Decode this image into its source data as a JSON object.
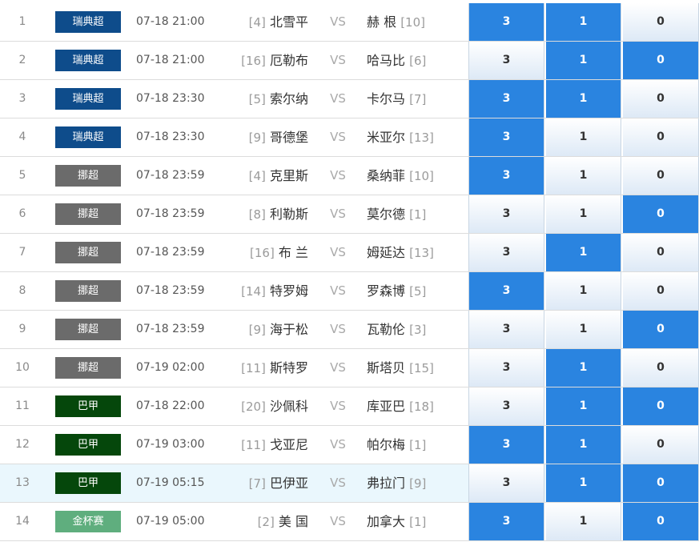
{
  "colors": {
    "selected_cell": "#2a84e0",
    "highlight_row": "#eaf7fd"
  },
  "leagues": {
    "瑞典超": "#0e4c8b",
    "挪超": "#6b6b6b",
    "巴甲": "#05470b",
    "金杯赛": "#5fae7e"
  },
  "vs_label": "VS",
  "matches": [
    {
      "num": "1",
      "league": "瑞典超",
      "time": "07-18 21:00",
      "home_rank": "[4]",
      "home": "北雪平",
      "away": "赫 根",
      "away_rank": "[10]",
      "win": "3",
      "draw": "1",
      "lose": "0",
      "selected": [
        true,
        true,
        false
      ],
      "highlight": false
    },
    {
      "num": "2",
      "league": "瑞典超",
      "time": "07-18 21:00",
      "home_rank": "[16]",
      "home": "厄勒布",
      "away": "哈马比",
      "away_rank": "[6]",
      "win": "3",
      "draw": "1",
      "lose": "0",
      "selected": [
        false,
        true,
        true
      ],
      "highlight": false
    },
    {
      "num": "3",
      "league": "瑞典超",
      "time": "07-18 23:30",
      "home_rank": "[5]",
      "home": "索尔纳",
      "away": "卡尔马",
      "away_rank": "[7]",
      "win": "3",
      "draw": "1",
      "lose": "0",
      "selected": [
        true,
        true,
        false
      ],
      "highlight": false
    },
    {
      "num": "4",
      "league": "瑞典超",
      "time": "07-18 23:30",
      "home_rank": "[9]",
      "home": "哥德堡",
      "away": "米亚尔",
      "away_rank": "[13]",
      "win": "3",
      "draw": "1",
      "lose": "0",
      "selected": [
        true,
        false,
        false
      ],
      "highlight": false
    },
    {
      "num": "5",
      "league": "挪超",
      "time": "07-18 23:59",
      "home_rank": "[4]",
      "home": "克里斯",
      "away": "桑纳菲",
      "away_rank": "[10]",
      "win": "3",
      "draw": "1",
      "lose": "0",
      "selected": [
        true,
        false,
        false
      ],
      "highlight": false
    },
    {
      "num": "6",
      "league": "挪超",
      "time": "07-18 23:59",
      "home_rank": "[8]",
      "home": "利勒斯",
      "away": "莫尔德",
      "away_rank": "[1]",
      "win": "3",
      "draw": "1",
      "lose": "0",
      "selected": [
        false,
        false,
        true
      ],
      "highlight": false
    },
    {
      "num": "7",
      "league": "挪超",
      "time": "07-18 23:59",
      "home_rank": "[16]",
      "home": "布 兰",
      "away": "姆延达",
      "away_rank": "[13]",
      "win": "3",
      "draw": "1",
      "lose": "0",
      "selected": [
        false,
        true,
        false
      ],
      "highlight": false
    },
    {
      "num": "8",
      "league": "挪超",
      "time": "07-18 23:59",
      "home_rank": "[14]",
      "home": "特罗姆",
      "away": "罗森博",
      "away_rank": "[5]",
      "win": "3",
      "draw": "1",
      "lose": "0",
      "selected": [
        true,
        false,
        false
      ],
      "highlight": false
    },
    {
      "num": "9",
      "league": "挪超",
      "time": "07-18 23:59",
      "home_rank": "[9]",
      "home": "海于松",
      "away": "瓦勒伦",
      "away_rank": "[3]",
      "win": "3",
      "draw": "1",
      "lose": "0",
      "selected": [
        false,
        false,
        true
      ],
      "highlight": false
    },
    {
      "num": "10",
      "league": "挪超",
      "time": "07-19 02:00",
      "home_rank": "[11]",
      "home": "斯特罗",
      "away": "斯塔贝",
      "away_rank": "[15]",
      "win": "3",
      "draw": "1",
      "lose": "0",
      "selected": [
        false,
        true,
        false
      ],
      "highlight": false
    },
    {
      "num": "11",
      "league": "巴甲",
      "time": "07-18 22:00",
      "home_rank": "[20]",
      "home": "沙佩科",
      "away": "库亚巴",
      "away_rank": "[18]",
      "win": "3",
      "draw": "1",
      "lose": "0",
      "selected": [
        false,
        true,
        true
      ],
      "highlight": false
    },
    {
      "num": "12",
      "league": "巴甲",
      "time": "07-19 03:00",
      "home_rank": "[11]",
      "home": "戈亚尼",
      "away": "帕尔梅",
      "away_rank": "[1]",
      "win": "3",
      "draw": "1",
      "lose": "0",
      "selected": [
        true,
        true,
        false
      ],
      "highlight": false
    },
    {
      "num": "13",
      "league": "巴甲",
      "time": "07-19 05:15",
      "home_rank": "[7]",
      "home": "巴伊亚",
      "away": "弗拉门",
      "away_rank": "[9]",
      "win": "3",
      "draw": "1",
      "lose": "0",
      "selected": [
        false,
        true,
        true
      ],
      "highlight": true
    },
    {
      "num": "14",
      "league": "金杯赛",
      "time": "07-19 05:00",
      "home_rank": "[2]",
      "home": "美 国",
      "away": "加拿大",
      "away_rank": "[1]",
      "win": "3",
      "draw": "1",
      "lose": "0",
      "selected": [
        true,
        false,
        true
      ],
      "highlight": false
    }
  ]
}
